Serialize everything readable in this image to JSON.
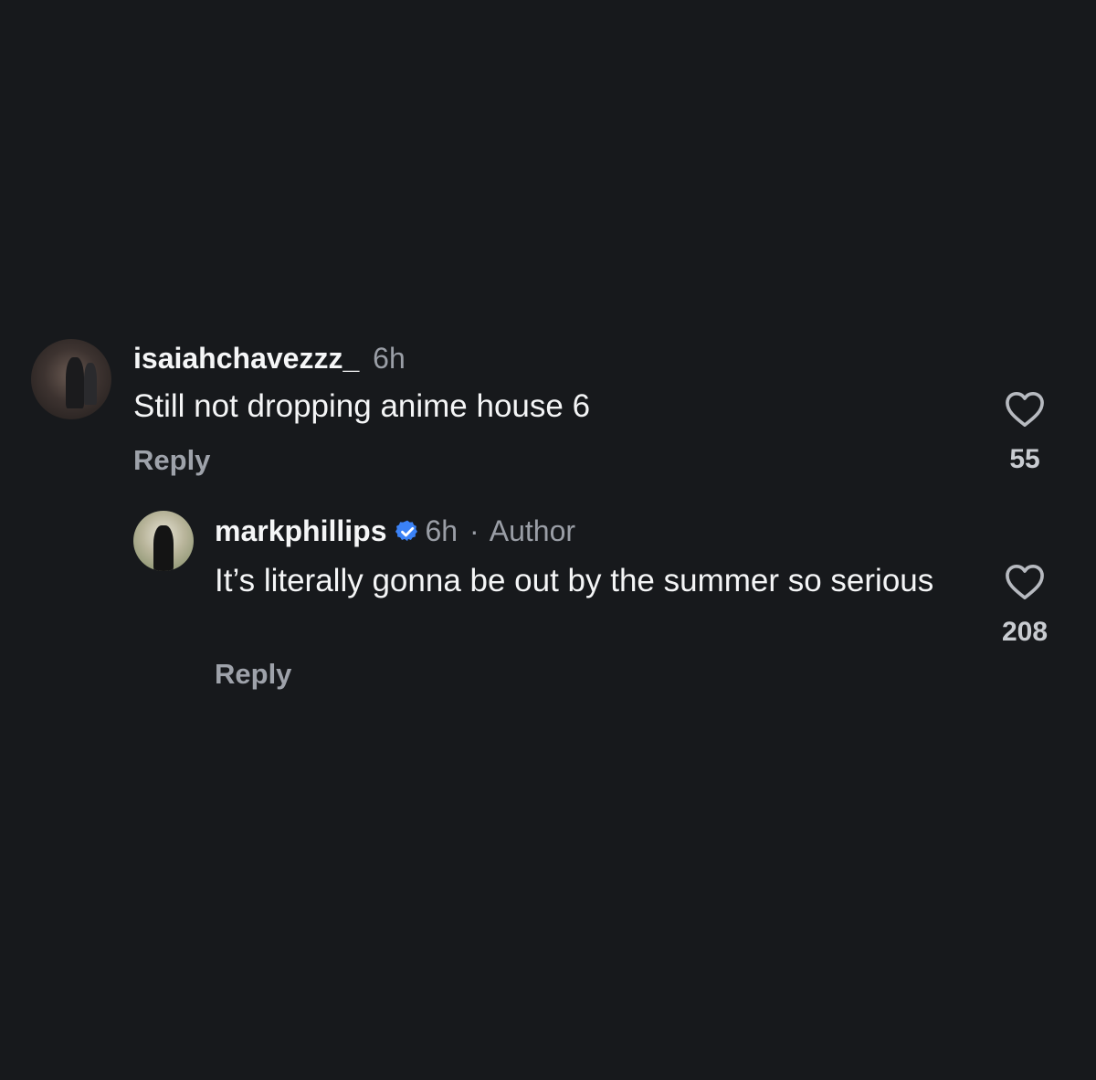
{
  "comments": [
    {
      "username": "isaiahchavezzz_",
      "time": "6h",
      "text": "Still not dropping anime house 6",
      "reply_label": "Reply",
      "likes": "55"
    }
  ],
  "replies": [
    {
      "username": "markphillips",
      "verified": true,
      "time": "6h",
      "separator": "·",
      "badge": "Author",
      "text": "It’s literally gonna be out by the summer so serious",
      "reply_label": "Reply",
      "likes": "208"
    }
  ],
  "colors": {
    "background": "#17191c",
    "verified_badge": "#3b82f6",
    "muted_text": "#9a9ea6"
  },
  "icons": {
    "like": "heart-outline-icon",
    "verified": "verified-check-icon"
  }
}
